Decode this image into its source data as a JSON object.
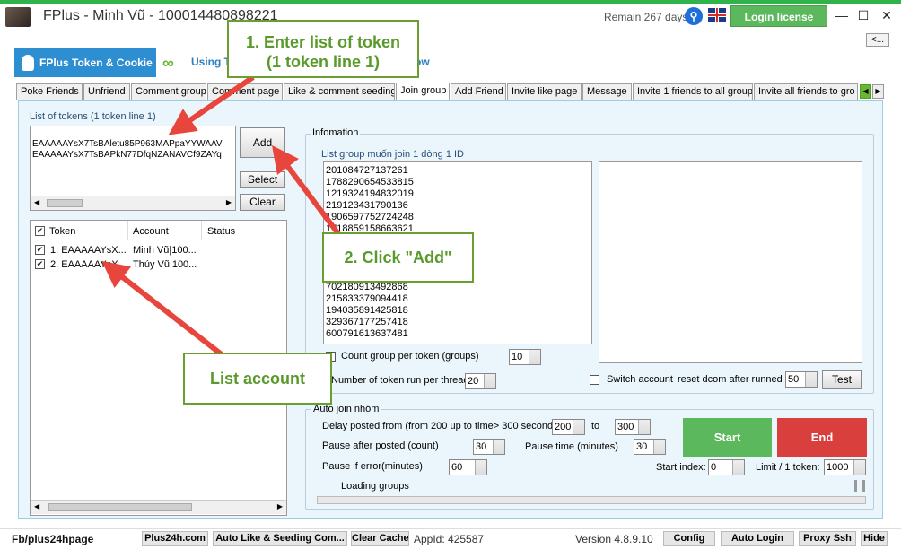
{
  "window": {
    "title": "FPlus - Minh Vũ - 100014480898221",
    "remain": "Remain 267 days",
    "login_label": "Login license",
    "minimize": "—",
    "maximize": "☐",
    "close": "✕",
    "back_label": "<..."
  },
  "header_tabs": {
    "fplus": "FPlus Token & Cookie",
    "using_partial": "Using T",
    "hidden_partial": "ow"
  },
  "tabs": [
    "Poke Friends",
    "Unfriend",
    "Comment group",
    "Comment page",
    "Like & comment seeding",
    "Join group",
    "Add Friend",
    "Invite like page",
    "Message",
    "Invite 1 friends to all group",
    "Invite all friends to gro"
  ],
  "left": {
    "tokens_label": "List of tokens (1 token line 1)",
    "token_lines": [
      "EAAAAAYsX7TsBAletu85P963MAPpaYYWAAV",
      "EAAAAAYsX7TsBAPkN77DfqNZANAVCf9ZAYq"
    ],
    "add": "Add",
    "select": "Select",
    "clear": "Clear",
    "columns": [
      "Token",
      "Account",
      "Status"
    ],
    "rows": [
      {
        "token": "1. EAAAAAYsX...",
        "account": "Minh Vũ|100..."
      },
      {
        "token": "2. EAAAAAYsX...",
        "account": "Thúy Vũ|100..."
      }
    ]
  },
  "info": {
    "title": "Infomation",
    "group_label": "List group muốn join 1 dòng 1 ID",
    "ids_top": [
      "201084727137261",
      "1788290654533815",
      "1219324194832019",
      "219123431790136",
      "1906597752724248",
      "1718859158663621"
    ],
    "ids_bottom": [
      "702180913492868",
      "215833379094418",
      "194035891425818",
      "329367177257418",
      "600791613637481"
    ],
    "count_label": "Count group per token (groups)",
    "count_value": "10",
    "tokens_thread_label": "Number of token run per thread:",
    "tokens_thread_value": "20",
    "switch_label": "Switch account",
    "reset_label": "reset dcom after runned",
    "reset_value": "50",
    "test": "Test"
  },
  "auto": {
    "title": "Auto join nhóm",
    "delay_label": "Delay posted from (from 200 up to time> 300 seconds)",
    "delay_from": "200",
    "to": "to",
    "delay_to": "300",
    "pause_after_label": "Pause after posted (count)",
    "pause_after": "30",
    "pause_time_label": "Pause time (minutes)",
    "pause_time": "30",
    "pause_error_label": "Pause if error(minutes)",
    "pause_error": "60",
    "start_index_label": "Start index:",
    "start_index": "0",
    "limit_label": "Limit / 1 token:",
    "limit": "1000",
    "start": "Start",
    "end": "End",
    "loading": "Loading groups"
  },
  "status_bar": {
    "fb": "Fb/plus24hpage",
    "plus24h": "Plus24h.com",
    "auto_like": "Auto Like & Seeding Com...",
    "clear_cache": "Clear Cache",
    "appid": "AppId: 425587",
    "version": "Version 4.8.9.10",
    "config": "Config",
    "auto_login": "Auto Login",
    "proxy_ssh": "Proxy Ssh",
    "hide": "Hide"
  },
  "callouts": {
    "step1_line1": "1. Enter list of token",
    "step1_line2": "(1 token line 1)",
    "step2": "2. Click \"Add\"",
    "list_account": "List account"
  },
  "colors": {
    "accent_green": "#5cb85c",
    "danger_red": "#d9403d",
    "tab_blue": "#2d8fd1",
    "annotation_arrow": "#e8463c"
  }
}
